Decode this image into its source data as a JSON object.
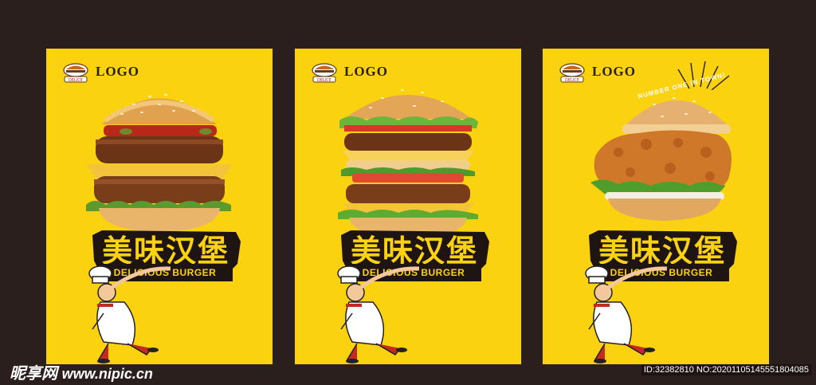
{
  "posters": [
    {
      "logo_text": "LOGO",
      "badge_text": "DELICE",
      "title_cn": "美味汉堡",
      "title_en": "DELICIOUS BURGER"
    },
    {
      "logo_text": "LOGO",
      "badge_text": "DELICE",
      "title_cn": "美味汉堡",
      "title_en": "DELICIOUS BURGER"
    },
    {
      "logo_text": "LOGO",
      "badge_text": "DELICE",
      "title_cn": "美味汉堡",
      "title_en": "DELICIOUS BURGER",
      "slogan": "NUMBER ONE IN TOWN!"
    }
  ],
  "watermark": {
    "brand": "昵享网",
    "url": "www.nipic.cn"
  },
  "image_id": "ID:32382810 NO:20201105145551804085",
  "colors": {
    "background": "#2b1f1d",
    "poster": "#fbd20f",
    "banner": "#1e1512"
  }
}
